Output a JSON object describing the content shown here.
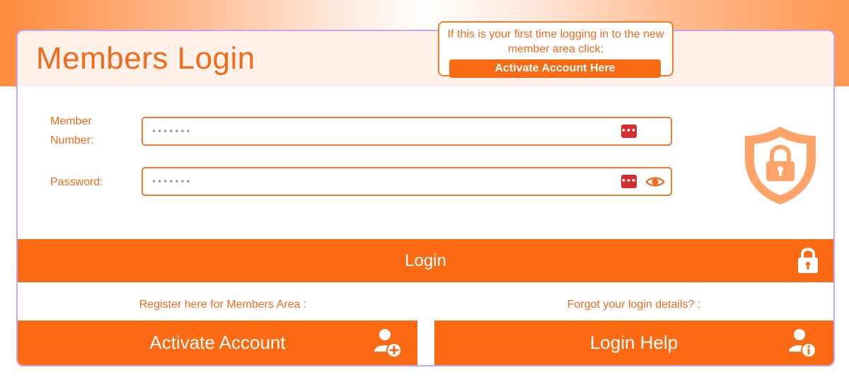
{
  "header": {
    "title": "Members Login"
  },
  "callout": {
    "text": "If this is your first time logging in to the new member area click:",
    "button_label": "Activate Account Here"
  },
  "form": {
    "member_number": {
      "label": "Member Number:",
      "value": "•••••••"
    },
    "password": {
      "label": "Password:",
      "value": "•••••••"
    }
  },
  "login_button": {
    "label": "Login"
  },
  "register": {
    "prompt": "Register here for Members Area :",
    "button_label": "Activate Account"
  },
  "help": {
    "prompt": "Forgot your login details? :",
    "button_label": "Login Help"
  },
  "colors": {
    "accent": "#fb6a12",
    "text_accent": "#f26a1c",
    "card_border": "#c4a5f2",
    "password_manager_icon": "#d62e2e"
  },
  "icons": [
    "password-manager-icon",
    "eye-icon",
    "shield-lock-icon",
    "lock-icon",
    "user-add-icon",
    "user-info-icon"
  ]
}
